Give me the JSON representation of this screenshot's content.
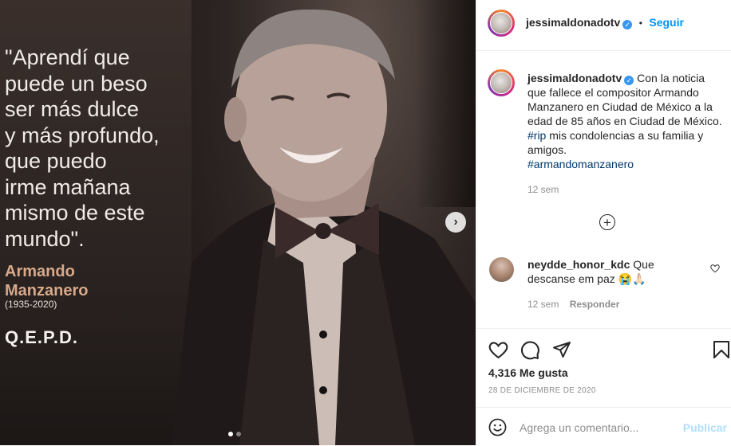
{
  "photo": {
    "quote": "\"Aprendí que\npuede un beso\nser más dulce\ny más profundo,\nque puedo\nirme mañana\nmismo de este\nmundo\".",
    "author": "Armando\nManzanero",
    "years": "(1935-2020)",
    "rip": "Q.E.P.D.",
    "next_symbol": "›",
    "carousel_total": 2,
    "carousel_active": 1
  },
  "header": {
    "username": "jessimaldonadotv",
    "verified_symbol": "✓",
    "separator": "•",
    "follow_label": "Seguir"
  },
  "caption": {
    "username": "jessimaldonadotv",
    "text_before_tag": "Con la noticia que fallece el compositor Armando Manzanero en Ciudad de México a la edad de 85 años en Ciudad de México. ",
    "tag1": "#rip",
    "text_after_tag": " mis condolencias a su familia y amigos.",
    "tag2": "#armandomanzanero",
    "time": "12 sem"
  },
  "comment": {
    "username": "neydde_honor_kdc",
    "text": "Que descanse em paz 😭🙏🏻",
    "time": "12 sem",
    "reply_label": "Responder"
  },
  "post": {
    "likes": "4,316 Me gusta",
    "date": "28 DE DICIEMBRE DE 2020",
    "comment_placeholder": "Agrega un comentario...",
    "publish_label": "Publicar"
  },
  "colors": {
    "link": "#0095f6",
    "hashtag": "#00376b",
    "muted": "#8e8e8e",
    "author_accent": "#d8a98a",
    "publish_disabled": "#b2dffc"
  },
  "icons": [
    "verified-icon",
    "heart-icon",
    "comment-icon",
    "share-icon",
    "bookmark-icon",
    "emoji-icon",
    "add-comment-circle-icon",
    "next-arrow-icon"
  ]
}
